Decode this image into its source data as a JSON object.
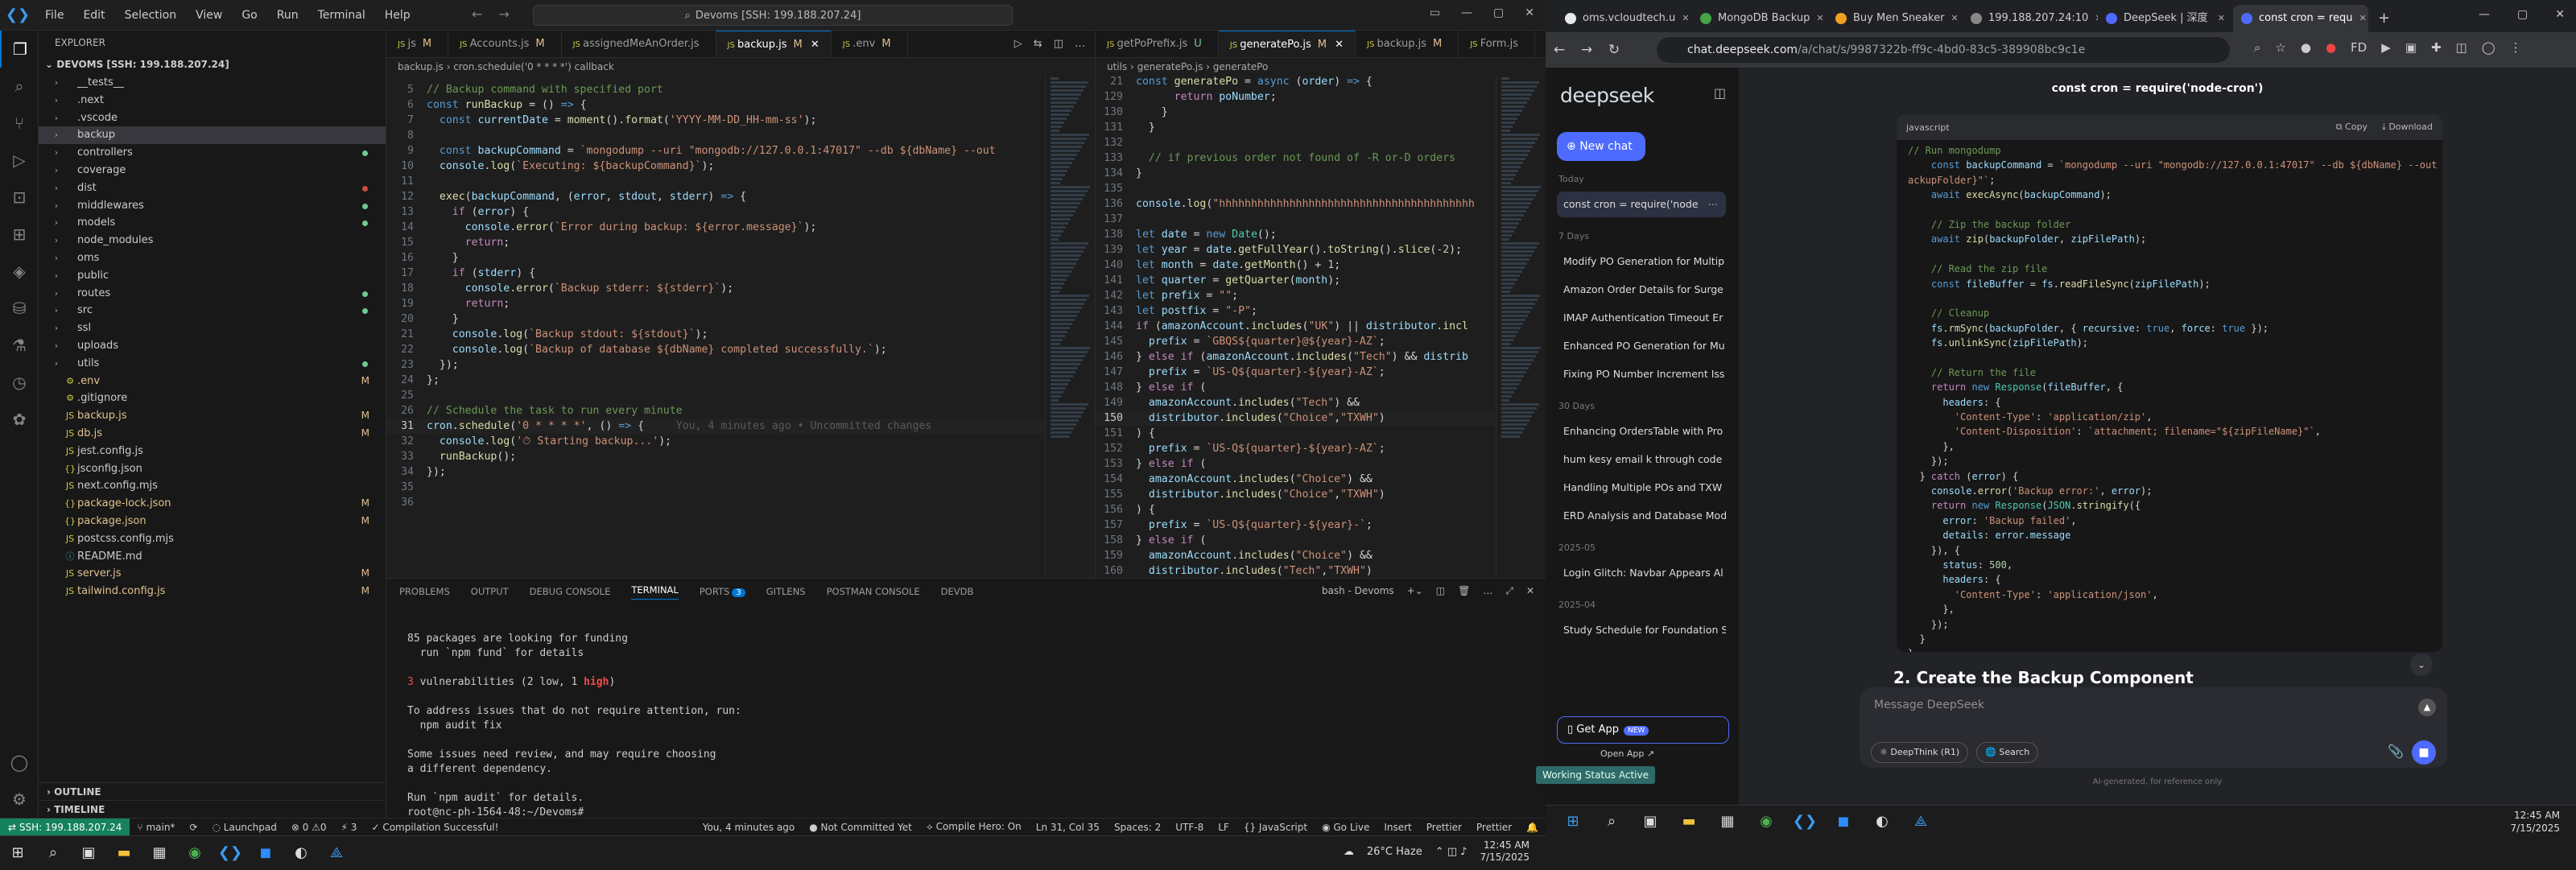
{
  "vscode": {
    "menu": [
      "File",
      "Edit",
      "Selection",
      "View",
      "Go",
      "Run",
      "Terminal",
      "Help"
    ],
    "search": "Devoms [SSH: 199.188.207.24]",
    "explorer_title": "EXPLORER",
    "root": "DEVOMS [SSH: 199.188.207.24]",
    "tree": [
      {
        "name": "__tests__",
        "type": "folder"
      },
      {
        "name": ".next",
        "type": "folder"
      },
      {
        "name": ".vscode",
        "type": "folder"
      },
      {
        "name": "backup",
        "type": "folder",
        "selected": true
      },
      {
        "name": "controllers",
        "type": "folder",
        "dot": "#73c991"
      },
      {
        "name": "coverage",
        "type": "folder"
      },
      {
        "name": "dist",
        "type": "folder",
        "dot": "#c74e39"
      },
      {
        "name": "middlewares",
        "type": "folder",
        "dot": "#73c991"
      },
      {
        "name": "models",
        "type": "folder",
        "dot": "#73c991"
      },
      {
        "name": "node_modules",
        "type": "folder"
      },
      {
        "name": "oms",
        "type": "folder"
      },
      {
        "name": "public",
        "type": "folder"
      },
      {
        "name": "routes",
        "type": "folder",
        "dot": "#73c991"
      },
      {
        "name": "src",
        "type": "folder",
        "dot": "#73c991"
      },
      {
        "name": "ssl",
        "type": "folder"
      },
      {
        "name": "uploads",
        "type": "folder"
      },
      {
        "name": "utils",
        "type": "folder",
        "dot": "#73c991"
      },
      {
        "name": ".env",
        "type": "file",
        "badge": "M",
        "color": "#e2c08d"
      },
      {
        "name": ".gitignore",
        "type": "file"
      },
      {
        "name": "backup.js",
        "type": "file",
        "badge": "M",
        "color": "#e2c08d"
      },
      {
        "name": "db.js",
        "type": "file",
        "badge": "M",
        "color": "#e2c08d"
      },
      {
        "name": "jest.config.js",
        "type": "file"
      },
      {
        "name": "jsconfig.json",
        "type": "file"
      },
      {
        "name": "next.config.mjs",
        "type": "file"
      },
      {
        "name": "package-lock.json",
        "type": "file",
        "badge": "M",
        "color": "#e2c08d"
      },
      {
        "name": "package.json",
        "type": "file",
        "badge": "M",
        "color": "#e2c08d"
      },
      {
        "name": "postcss.config.mjs",
        "type": "file"
      },
      {
        "name": "README.md",
        "type": "file"
      },
      {
        "name": "server.js",
        "type": "file",
        "badge": "M",
        "color": "#e2c08d"
      },
      {
        "name": "tailwind.config.js",
        "type": "file",
        "badge": "M",
        "color": "#e2c08d"
      }
    ],
    "outline": "OUTLINE",
    "timeline": "TIMELINE",
    "left_tabs": [
      {
        "label": "js",
        "mod": "M"
      },
      {
        "label": "Accounts.js",
        "mod": "M"
      },
      {
        "label": "assignedMeAnOrder.js",
        "mod": ""
      },
      {
        "label": "backup.js",
        "mod": "M",
        "active": true
      },
      {
        "label": ".env",
        "mod": "M"
      }
    ],
    "left_breadcrumb": "backup.js › cron.schedule('0 * * * *') callback",
    "left_code": [
      {
        "n": "",
        "h": "<span class='c'>// Backup command with specified port</span>"
      },
      {
        "n": "",
        "h": "<span class='k'>const</span> <span class='f'>runBackup</span> = () <span class='k'>=></span> {"
      },
      {
        "n": "",
        "h": "  <span class='k'>const</span> <span class='v'>currentDate</span> = <span class='f'>moment</span>().<span class='f'>format</span>(<span class='s'>'YYYY-MM-DD_HH-mm-ss'</span>);"
      },
      {
        "n": "",
        "h": ""
      },
      {
        "n": "",
        "h": "  <span class='k'>const</span> <span class='v'>backupCommand</span> = <span class='s'>`mongodump --uri \"mongodb://127.0.0.1:47017\" --db ${dbName} --out</span>"
      },
      {
        "n": "",
        "h": "  <span class='v'>console</span>.<span class='f'>log</span>(<span class='s'>`Executing: ${backupCommand}`</span>);"
      },
      {
        "n": "",
        "h": ""
      },
      {
        "n": "",
        "h": "  <span class='f'>exec</span>(<span class='v'>backupCommand</span>, (<span class='v'>error</span>, <span class='v'>stdout</span>, <span class='v'>stderr</span>) <span class='k'>=></span> {"
      },
      {
        "n": "",
        "h": "    <span class='p'>if</span> (<span class='v'>error</span>) {"
      },
      {
        "n": "",
        "h": "      <span class='v'>console</span>.<span class='f'>error</span>(<span class='s'>`Error during backup: ${error.message}`</span>);"
      },
      {
        "n": "",
        "h": "      <span class='p'>return</span>;"
      },
      {
        "n": "",
        "h": "    }"
      },
      {
        "n": "",
        "h": "    <span class='p'>if</span> (<span class='v'>stderr</span>) {"
      },
      {
        "n": "",
        "h": "      <span class='v'>console</span>.<span class='f'>error</span>(<span class='s'>`Backup stderr: ${stderr}`</span>);"
      },
      {
        "n": "",
        "h": "      <span class='p'>return</span>;"
      },
      {
        "n": "",
        "h": "    }"
      },
      {
        "n": "",
        "h": "    <span class='v'>console</span>.<span class='f'>log</span>(<span class='s'>`Backup stdout: ${stdout}`</span>);"
      },
      {
        "n": "",
        "h": "    <span class='v'>console</span>.<span class='f'>log</span>(<span class='s'>`Backup of database ${dbName} completed successfully.`</span>);"
      },
      {
        "n": "",
        "h": "  });"
      },
      {
        "n": "",
        "h": "};"
      },
      {
        "n": "",
        "h": ""
      },
      {
        "n": "",
        "h": "<span class='c'>// Schedule the task to run every minute</span>"
      },
      {
        "n": "31",
        "h": "<span class='v'>cron</span>.<span class='f'>schedule</span>(<span class='s'>'0 * * * *'</span>, () <span class='k'>=></span> {     <span style='color:#5a5a5a'>You, 4 minutes ago • Uncommitted changes</span>",
        "cur": true
      },
      {
        "n": "32",
        "h": "  <span class='v'>console</span>.<span class='f'>log</span>(<span class='s'>'&#9201; Starting backup...'</span>);"
      },
      {
        "n": "33",
        "h": "  <span class='f'>runBackup</span>();"
      },
      {
        "n": "34",
        "h": "});"
      },
      {
        "n": "35",
        "h": ""
      },
      {
        "n": "36",
        "h": ""
      }
    ],
    "right_tabs": [
      {
        "label": "getPoPrefix.js",
        "mod": "U"
      },
      {
        "label": "generatePo.js",
        "mod": "M",
        "active": true
      },
      {
        "label": "backup.js",
        "mod": "M"
      },
      {
        "label": "Form.js",
        "mod": ""
      }
    ],
    "right_breadcrumb": "utils › generatePo.js › generatePo",
    "right_code": [
      {
        "n": "21",
        "h": "<span class='k'>const</span> <span class='f'>generatePo</span> = <span class='k'>async</span> (<span class='v'>order</span>) <span class='k'>=></span> {"
      },
      {
        "n": "129",
        "h": "      <span class='p'>return</span> <span class='v'>poNumber</span>;"
      },
      {
        "n": "130",
        "h": "    }"
      },
      {
        "n": "131",
        "h": "  }"
      },
      {
        "n": "132",
        "h": ""
      },
      {
        "n": "133",
        "h": "  <span class='c'>// if previous order not found of -R or-D orders</span>"
      },
      {
        "n": "134",
        "h": "}"
      },
      {
        "n": "135",
        "h": ""
      },
      {
        "n": "136",
        "h": "<span class='v'>console</span>.<span class='f'>log</span>(<span class='s'>\"hhhhhhhhhhhhhhhhhhhhhhhhhhhhhhhhhhhhhhhh</span>"
      },
      {
        "n": "137",
        "h": ""
      },
      {
        "n": "138",
        "h": "<span class='k'>let</span> <span class='v'>date</span> = <span class='k'>new</span> <span class='t'>Date</span>();"
      },
      {
        "n": "139",
        "h": "<span class='k'>let</span> <span class='v'>year</span> = <span class='v'>date</span>.<span class='f'>getFullYear</span>().<span class='f'>toString</span>().<span class='f'>slice</span>(<span class='n'>-2</span>);"
      },
      {
        "n": "140",
        "h": "<span class='k'>let</span> <span class='v'>month</span> = <span class='v'>date</span>.<span class='f'>getMonth</span>() + <span class='n'>1</span>;"
      },
      {
        "n": "141",
        "h": "<span class='k'>let</span> <span class='v'>quarter</span> = <span class='f'>getQuarter</span>(<span class='v'>month</span>);"
      },
      {
        "n": "142",
        "h": "<span class='k'>let</span> <span class='v'>prefix</span> = <span class='s'>\"\"</span>;"
      },
      {
        "n": "143",
        "h": "<span class='k'>let</span> <span class='v'>postfix</span> = <span class='s'>\"-P\"</span>;"
      },
      {
        "n": "144",
        "h": "<span class='p'>if</span> (<span class='v'>amazonAccount</span>.<span class='f'>includes</span>(<span class='s'>\"UK\"</span>) || <span class='v'>distributor</span>.<span class='f'>incl</span>"
      },
      {
        "n": "145",
        "h": "  <span class='v'>prefix</span> = <span class='s'>`GBQS${quarter}@${year}-AZ`</span>;"
      },
      {
        "n": "146",
        "h": "} <span class='p'>else if</span> (<span class='v'>amazonAccount</span>.<span class='f'>includes</span>(<span class='s'>\"Tech\"</span>) && <span class='v'>distrib</span>"
      },
      {
        "n": "147",
        "h": "  <span class='v'>prefix</span> = <span class='s'>`US-Q${quarter}-${year}-AZ`</span>;"
      },
      {
        "n": "148",
        "h": "} <span class='p'>else if</span> ("
      },
      {
        "n": "149",
        "h": "  <span class='v'>amazonAccount</span>.<span class='f'>includes</span>(<span class='s'>\"Tech\"</span>) &&"
      },
      {
        "n": "150",
        "h": "  <span class='v'>distributor</span>.<span class='f'>includes</span>(<span class='s'>\"Choice\"</span>,<span class='s'>\"TXWH\"</span>)",
        "cur": true
      },
      {
        "n": "151",
        "h": ") {"
      },
      {
        "n": "152",
        "h": "  <span class='v'>prefix</span> = <span class='s'>`US-Q${quarter}-${year}-AZ`</span>;"
      },
      {
        "n": "153",
        "h": "} <span class='p'>else if</span> ("
      },
      {
        "n": "154",
        "h": "  <span class='v'>amazonAccount</span>.<span class='f'>includes</span>(<span class='s'>\"Choice\"</span>) &&"
      },
      {
        "n": "155",
        "h": "  <span class='v'>distributor</span>.<span class='f'>includes</span>(<span class='s'>\"Choice\"</span>,<span class='s'>\"TXWH\"</span>)"
      },
      {
        "n": "156",
        "h": ") {"
      },
      {
        "n": "157",
        "h": "  <span class='v'>prefix</span> = <span class='s'>`US-Q${quarter}-${year}-`</span>;"
      },
      {
        "n": "158",
        "h": "} <span class='p'>else if</span> ("
      },
      {
        "n": "159",
        "h": "  <span class='v'>amazonAccount</span>.<span class='f'>includes</span>(<span class='s'>\"Choice\"</span>) &&"
      },
      {
        "n": "160",
        "h": "  <span class='v'>distributor</span>.<span class='f'>includes</span>(<span class='s'>\"Tech\"</span>,<span class='s'>\"TXWH\"</span>)"
      }
    ],
    "panel_tabs": [
      "PROBLEMS",
      "OUTPUT",
      "DEBUG CONSOLE",
      "TERMINAL",
      "PORTS",
      "GITLENS",
      "POSTMAN CONSOLE",
      "DEVDB"
    ],
    "ports_count": "3",
    "terminal_name": "bash - Devoms",
    "terminal": [
      "",
      "85 packages are looking for funding",
      "  run `npm fund` for details",
      "",
      "3 vulnerabilities (2 low, 1 high)",
      "",
      "To address issues that do not require attention, run:",
      "  npm audit fix",
      "",
      "Some issues need review, and may require choosing",
      "a different dependency.",
      "",
      "Run `npm audit` for details.",
      "root@nc-ph-1564-48:~/Devoms# "
    ],
    "status": {
      "remote": "SSH: 199.188.207.24",
      "branch": "main*",
      "launchpad": "Launchpad",
      "problems": "0 ⚠0",
      "ports": "3",
      "compile": "Compilation Successful!",
      "blame": "You, 4 minutes ago",
      "commit": "Not Committed Yet",
      "hero": "Compile Hero: On",
      "position": "Ln 31, Col 35",
      "spaces": "Spaces: 2",
      "encoding": "UTF-8",
      "eol": "LF",
      "lang": "JavaScript",
      "golive": "Go Live",
      "insert": "Insert",
      "prettier1": "Prettier",
      "prettier2": "Prettier"
    },
    "weather": "26°C  Haze",
    "time": "12:45 AM",
    "date": "7/15/2025"
  },
  "browser": {
    "tabs": [
      {
        "label": "oms.vcloudtech.u",
        "color": "#e8eaed"
      },
      {
        "label": "MongoDB Backup",
        "color": "#47a248"
      },
      {
        "label": "Buy Men Sneaker",
        "color": "#f0a020"
      },
      {
        "label": "199.188.207.24:10",
        "color": "#888"
      },
      {
        "label": "DeepSeek | 深度",
        "color": "#4d6bfe"
      },
      {
        "label": "const cron = requ",
        "color": "#4d6bfe",
        "active": true
      }
    ],
    "url_host": "chat.deepseek.com",
    "url_path": "/a/chat/s/9987322b-ff9c-4bd0-83c5-389908bc9c1e"
  },
  "deepseek": {
    "logo": "deepseek",
    "new_chat": "New chat",
    "groups": [
      {
        "label": "Today",
        "items": [
          {
            "text": "const cron = require('node",
            "active": true
          }
        ]
      },
      {
        "label": "7 Days",
        "items": [
          {
            "text": "Modify PO Generation for Multip"
          },
          {
            "text": "Amazon Order Details for Surge"
          },
          {
            "text": "IMAP Authentication Timeout Er"
          },
          {
            "text": "Enhanced PO Generation for Mu"
          },
          {
            "text": "Fixing PO Number Increment Iss"
          }
        ]
      },
      {
        "label": "30 Days",
        "items": [
          {
            "text": "Enhancing OrdersTable with Pro"
          },
          {
            "text": "hum kesy email k through code"
          },
          {
            "text": "Handling Multiple POs and TXW"
          },
          {
            "text": "ERD Analysis and Database Mod"
          }
        ]
      },
      {
        "label": "2025-05",
        "items": [
          {
            "text": "Login Glitch: Navbar Appears Al"
          }
        ]
      },
      {
        "label": "2025-04",
        "items": [
          {
            "text": "Study Schedule for Foundation S"
          }
        ]
      }
    ],
    "get_app": "Get App",
    "new_badge": "NEW",
    "open_app": "Open App ↗",
    "toast": "Working Status Active",
    "chat_title": "const cron = require('node-cron')",
    "code_lang": "javascript",
    "copy": "Copy",
    "download": "Download",
    "code": [
      "<span class='c'>// Run mongodump</span>",
      "    <span class='k'>const</span> <span class='v'>backupCommand</span> = <span class='s'>`mongodump --uri \"mongodb://127.0.0.1:47017\" --db ${dbName} --out \"${b</span>",
      "<span class='s'>ackupFolder}\"`</span>;",
      "    <span class='k'>await</span> <span class='f'>execAsync</span>(<span class='v'>backupCommand</span>);",
      "",
      "    <span class='c'>// Zip the backup folder</span>",
      "    <span class='k'>await</span> <span class='f'>zip</span>(<span class='v'>backupFolder</span>, <span class='v'>zipFilePath</span>);",
      "",
      "    <span class='c'>// Read the zip file</span>",
      "    <span class='k'>const</span> <span class='v'>fileBuffer</span> = <span class='v'>fs</span>.<span class='f'>readFileSync</span>(<span class='v'>zipFilePath</span>);",
      "",
      "    <span class='c'>// Cleanup</span>",
      "    <span class='v'>fs</span>.<span class='f'>rmSync</span>(<span class='v'>backupFolder</span>, { <span class='v'>recursive</span>: <span class='k'>true</span>, <span class='v'>force</span>: <span class='k'>true</span> });",
      "    <span class='v'>fs</span>.<span class='f'>unlinkSync</span>(<span class='v'>zipFilePath</span>);",
      "",
      "    <span class='c'>// Return the file</span>",
      "    <span class='p'>return</span> <span class='k'>new</span> <span class='t'>Response</span>(<span class='v'>fileBuffer</span>, {",
      "      <span class='v'>headers</span>: {",
      "        <span class='s'>'Content-Type'</span>: <span class='s'>'application/zip'</span>,",
      "        <span class='s'>'Content-Disposition'</span>: <span class='s'>`attachment; filename=\"${zipFileName}\"`</span>,",
      "      },",
      "    });",
      "  } <span class='p'>catch</span> (<span class='v'>error</span>) {",
      "    <span class='v'>console</span>.<span class='f'>error</span>(<span class='s'>'Backup error:'</span>, <span class='v'>error</span>);",
      "    <span class='p'>return</span> <span class='k'>new</span> <span class='t'>Response</span>(<span class='t'>JSON</span>.<span class='f'>stringify</span>({",
      "      <span class='v'>error</span>: <span class='s'>'Backup failed'</span>,",
      "      <span class='v'>details</span>: <span class='v'>error</span>.<span class='v'>message</span>",
      "    }), {",
      "      <span class='v'>status</span>: <span class='n'>500</span>,",
      "      <span class='v'>headers</span>: {",
      "        <span class='s'>'Content-Type'</span>: <span class='s'>'application/json'</span>,",
      "      },",
      "    });",
      "  }",
      "}"
    ],
    "heading": "2. Create the Backup Component",
    "input_placeholder": "Message DeepSeek",
    "chip_deepthink": "DeepThink (R1)",
    "chip_search": "Search",
    "footer": "AI-generated, for reference only"
  }
}
